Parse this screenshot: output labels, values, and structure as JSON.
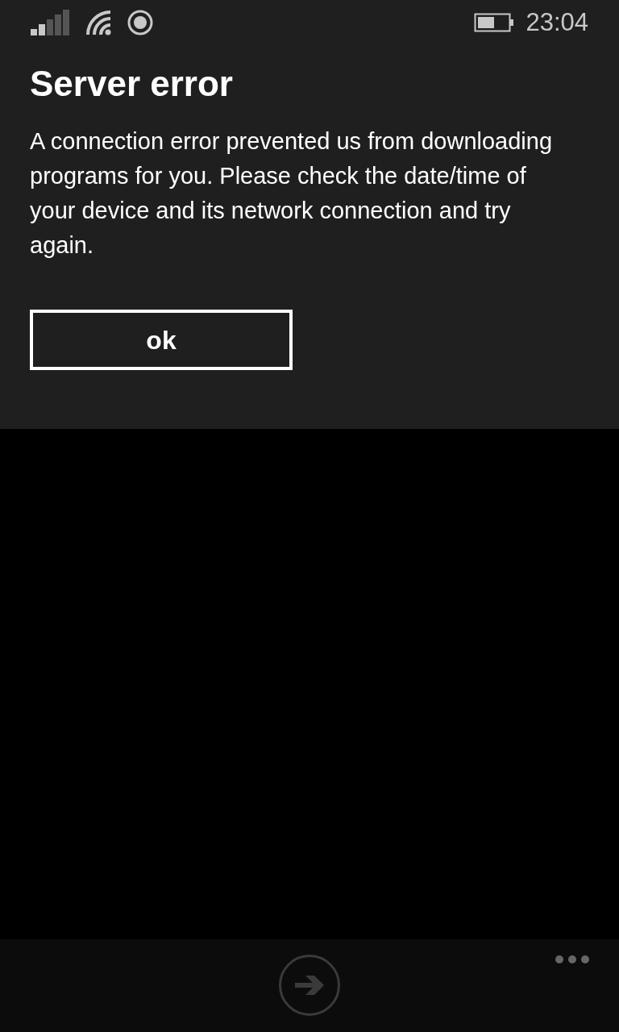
{
  "status_bar": {
    "time": "23:04"
  },
  "dialog": {
    "title": "Server error",
    "message": "A connection error prevented us from downloading programs for you. Please check the date/time of your device and its network connection and try again.",
    "button": "ok"
  },
  "app_bar": {
    "next_button": {
      "disabled": true
    }
  }
}
